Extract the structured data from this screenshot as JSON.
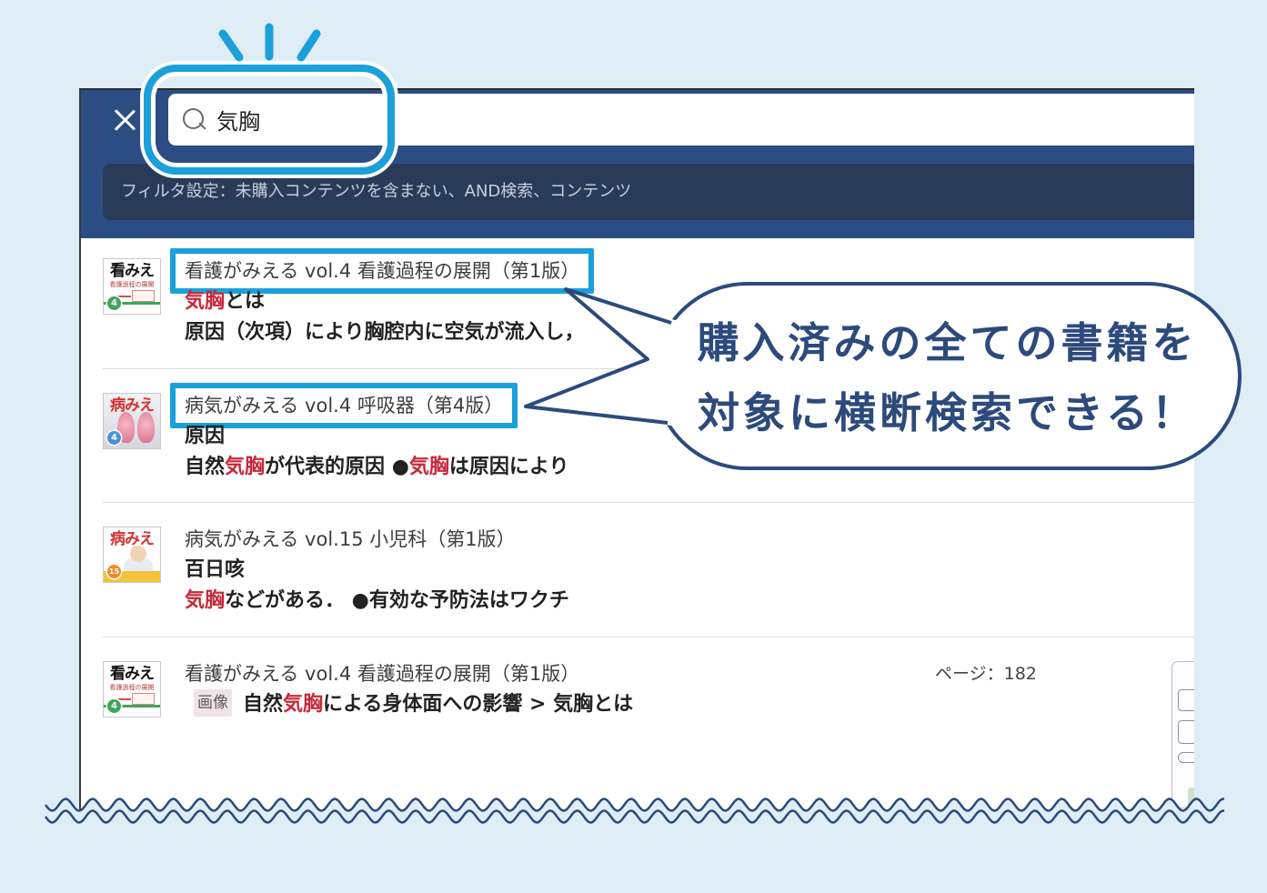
{
  "search": {
    "query": "気胸",
    "icons": {
      "close": "close-icon",
      "search": "search-icon"
    }
  },
  "filter": {
    "summary": "フィルタ設定：未購入コンテンツを含まない、AND検索、コンテンツ"
  },
  "results": [
    {
      "cover": {
        "label": "看みえ",
        "subtitle": "看護過程の展開",
        "number": "4"
      },
      "book": "看護がみえる vol.4 看護過程の展開（第1版）",
      "title_highlighted": true,
      "heading": [
        {
          "text": "気胸",
          "match": true
        },
        {
          "text": "とは",
          "match": false
        }
      ],
      "snippet": [
        {
          "text": "原因（次項）により胸腔内に空気が流入し，",
          "match": false
        }
      ]
    },
    {
      "cover": {
        "label": "病みえ",
        "number": "4"
      },
      "book": "病気がみえる vol.4 呼吸器（第4版）",
      "title_highlighted": true,
      "heading": [
        {
          "text": "原因",
          "match": false
        }
      ],
      "snippet": [
        {
          "text": "自然",
          "match": false
        },
        {
          "text": "気胸",
          "match": true
        },
        {
          "text": "が代表的原因 ●",
          "match": false
        },
        {
          "text": "気胸",
          "match": true
        },
        {
          "text": "は原因により",
          "match": false
        }
      ]
    },
    {
      "cover": {
        "label": "病みえ",
        "number": "15"
      },
      "book": "病気がみえる vol.15 小児科（第1版）",
      "title_highlighted": false,
      "heading": [
        {
          "text": "百日咳",
          "match": false
        }
      ],
      "snippet": [
        {
          "text": "気胸",
          "match": true
        },
        {
          "text": "などがある． ●有効な予防法はワクチ",
          "match": false
        }
      ]
    },
    {
      "cover": {
        "label": "看みえ",
        "subtitle": "看護過程の展開",
        "number": "4"
      },
      "book": "看護がみえる vol.4 看護過程の展開（第1版）",
      "title_highlighted": false,
      "page": "ページ：182",
      "badge": "画像",
      "path": [
        {
          "text": "自然",
          "match": false
        },
        {
          "text": "気胸",
          "match": true
        },
        {
          "text": "による身体面への影響 > 気胸とは",
          "match": false
        }
      ]
    }
  ],
  "callout": {
    "lines": [
      "購入済みの全ての書籍を",
      "対象に横断検索できる！"
    ]
  },
  "colors": {
    "background": "#deedf6",
    "header": "#2c4d83",
    "filter_bar": "#2a3b5a",
    "accent": "#1aa0da",
    "match": "#c8283a",
    "callout": "#2c4a7c",
    "wave": "#2b4a7b"
  }
}
